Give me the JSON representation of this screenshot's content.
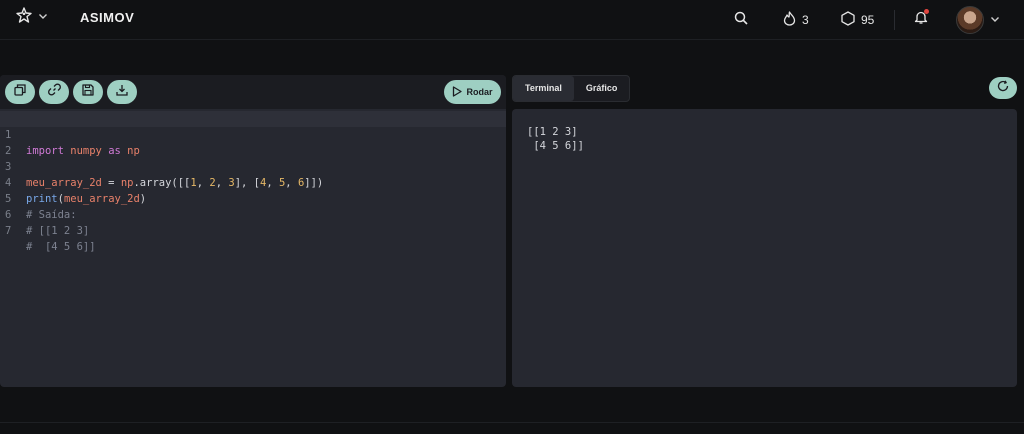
{
  "header": {
    "brand": "ASIMOV",
    "streak_count": "3",
    "gems_count": "95",
    "icons": {
      "logo": "star-person-icon",
      "search": "search-icon",
      "streak": "flame-icon",
      "gems": "hexagon-icon",
      "notifications": "bell-icon",
      "menu": "chevron-down-icon"
    }
  },
  "editor": {
    "toolbar": {
      "buttons": [
        "copy-icon",
        "link-icon",
        "save-icon",
        "download-icon"
      ],
      "run_label": "Rodar"
    },
    "lines": [
      {
        "n": "1"
      },
      {
        "n": "2"
      },
      {
        "n": "3"
      },
      {
        "n": "4"
      },
      {
        "n": "5",
        "text": "# Saída:"
      },
      {
        "n": "6",
        "text": "# [[1 2 3]"
      },
      {
        "n": "7",
        "text": "#  [4 5 6]]"
      }
    ],
    "tokens": {
      "l1_import": "import",
      "l1_numpy": " numpy ",
      "l1_as": "as",
      "l1_np": " np",
      "l3_var": "meu_array_2d",
      "l3_eq": " = ",
      "l3_np": "np",
      "l3_dot": ".array([[",
      "l3_n1": "1",
      "l3_c1": ", ",
      "l3_n2": "2",
      "l3_c2": ", ",
      "l3_n3": "3",
      "l3_mid": "], [",
      "l3_n4": "4",
      "l3_c3": ", ",
      "l3_n5": "5",
      "l3_c4": ", ",
      "l3_n6": "6",
      "l3_end": "]])",
      "l4_print": "print",
      "l4_open": "(",
      "l4_var": "meu_array_2d",
      "l4_close": ")"
    }
  },
  "output": {
    "tabs": [
      "Terminal",
      "Gráfico"
    ],
    "active_tab": "Terminal",
    "terminal_lines": [
      "[[1 2 3]",
      " [4 5 6]]"
    ]
  },
  "colors": {
    "accent": "#9ecfc2",
    "background": "#101113",
    "panel": "#262830"
  }
}
